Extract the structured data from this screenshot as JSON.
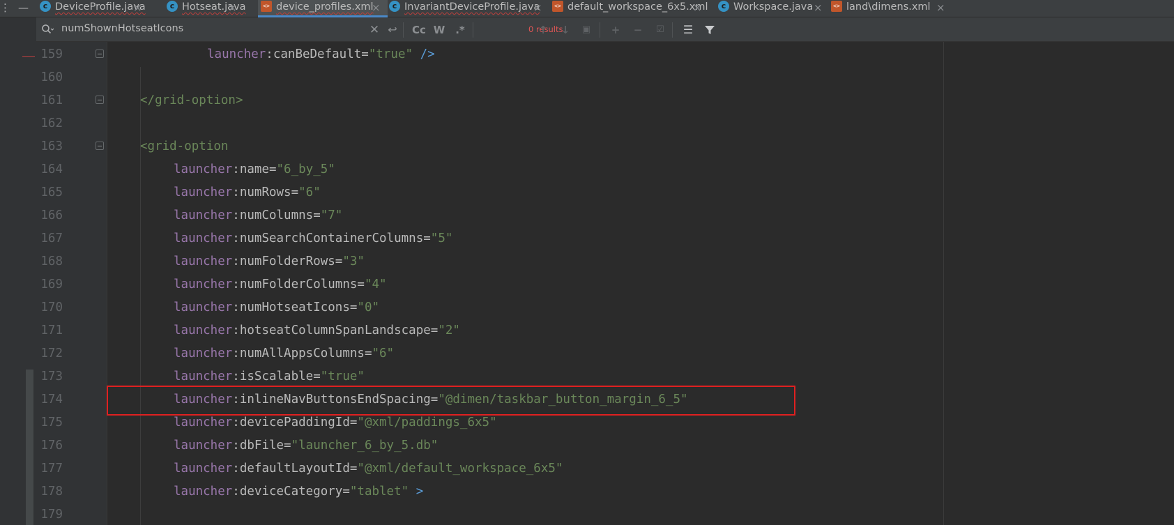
{
  "tabs": [
    {
      "label": "DeviceProfile.java",
      "icon": "java",
      "error": true
    },
    {
      "label": "Hotseat.java",
      "icon": "java",
      "error": true
    },
    {
      "label": "device_profiles.xml",
      "icon": "xml",
      "error": true,
      "active": true
    },
    {
      "label": "InvariantDeviceProfile.java",
      "icon": "java",
      "error": true
    },
    {
      "label": "default_workspace_6x5.xml",
      "icon": "xml",
      "error": false
    },
    {
      "label": "Workspace.java",
      "icon": "java",
      "error": false
    },
    {
      "label": "land\\dimens.xml",
      "icon": "xml",
      "error": false
    }
  ],
  "search": {
    "query": "numShownHotseatIcons",
    "results": "0 results",
    "match_case": "Cc",
    "words": "W",
    "regex": ".*"
  },
  "colors": {
    "namespace": "#9876aa",
    "string_value": "#6a8759",
    "tag": "#e8bf6a",
    "highlight_box": "#e02020",
    "results_text": "#e05555"
  },
  "code": {
    "lines": [
      {
        "num": "159",
        "parts": [
          {
            "t": "launcher",
            "c": "ns"
          },
          {
            "t": ":canBeDefault=",
            "c": "attr"
          },
          {
            "t": "\"true\"",
            "c": "val"
          },
          {
            "t": " />",
            "c": "selfclose"
          }
        ]
      },
      {
        "num": "160",
        "parts": []
      },
      {
        "num": "161",
        "parts": [
          {
            "t": "</grid-option>",
            "c": "val"
          }
        ]
      },
      {
        "num": "162",
        "parts": []
      },
      {
        "num": "163",
        "parts": [
          {
            "t": "<grid-option",
            "c": "val"
          }
        ]
      },
      {
        "num": "164",
        "parts": [
          {
            "t": "launcher",
            "c": "ns"
          },
          {
            "t": ":name=",
            "c": "attr"
          },
          {
            "t": "\"6_by_5\"",
            "c": "val"
          }
        ]
      },
      {
        "num": "165",
        "parts": [
          {
            "t": "launcher",
            "c": "ns"
          },
          {
            "t": ":numRows=",
            "c": "attr"
          },
          {
            "t": "\"6\"",
            "c": "val"
          }
        ]
      },
      {
        "num": "166",
        "parts": [
          {
            "t": "launcher",
            "c": "ns"
          },
          {
            "t": ":numColumns=",
            "c": "attr"
          },
          {
            "t": "\"7\"",
            "c": "val"
          }
        ]
      },
      {
        "num": "167",
        "parts": [
          {
            "t": "launcher",
            "c": "ns"
          },
          {
            "t": ":numSearchContainerColumns=",
            "c": "attr"
          },
          {
            "t": "\"5\"",
            "c": "val"
          }
        ]
      },
      {
        "num": "168",
        "parts": [
          {
            "t": "launcher",
            "c": "ns"
          },
          {
            "t": ":numFolderRows=",
            "c": "attr"
          },
          {
            "t": "\"3\"",
            "c": "val"
          }
        ]
      },
      {
        "num": "169",
        "parts": [
          {
            "t": "launcher",
            "c": "ns"
          },
          {
            "t": ":numFolderColumns=",
            "c": "attr"
          },
          {
            "t": "\"4\"",
            "c": "val"
          }
        ]
      },
      {
        "num": "170",
        "parts": [
          {
            "t": "launcher",
            "c": "ns"
          },
          {
            "t": ":numHotseatIcons=",
            "c": "attr"
          },
          {
            "t": "\"0\"",
            "c": "val"
          }
        ]
      },
      {
        "num": "171",
        "parts": [
          {
            "t": "launcher",
            "c": "ns"
          },
          {
            "t": ":hotseatColumnSpanLandscape=",
            "c": "attr"
          },
          {
            "t": "\"2\"",
            "c": "val"
          }
        ]
      },
      {
        "num": "172",
        "parts": [
          {
            "t": "launcher",
            "c": "ns"
          },
          {
            "t": ":numAllAppsColumns=",
            "c": "attr"
          },
          {
            "t": "\"6\"",
            "c": "val"
          }
        ]
      },
      {
        "num": "173",
        "parts": [
          {
            "t": "launcher",
            "c": "ns"
          },
          {
            "t": ":isScalable=",
            "c": "attr"
          },
          {
            "t": "\"true\"",
            "c": "val"
          }
        ]
      },
      {
        "num": "174",
        "parts": [
          {
            "t": "launcher",
            "c": "ns"
          },
          {
            "t": ":inlineNavButtonsEndSpacing=",
            "c": "attr"
          },
          {
            "t": "\"@dimen/taskbar_button_margin_6_5\"",
            "c": "val"
          }
        ]
      },
      {
        "num": "175",
        "parts": [
          {
            "t": "launcher",
            "c": "ns"
          },
          {
            "t": ":devicePaddingId=",
            "c": "attr"
          },
          {
            "t": "\"@xml/paddings_6x5\"",
            "c": "val"
          }
        ]
      },
      {
        "num": "176",
        "parts": [
          {
            "t": "launcher",
            "c": "ns"
          },
          {
            "t": ":dbFile=",
            "c": "attr"
          },
          {
            "t": "\"launcher_6_by_5.db\"",
            "c": "val"
          }
        ]
      },
      {
        "num": "177",
        "parts": [
          {
            "t": "launcher",
            "c": "ns"
          },
          {
            "t": ":defaultLayoutId=",
            "c": "attr"
          },
          {
            "t": "\"@xml/default_workspace_6x5\"",
            "c": "val"
          }
        ]
      },
      {
        "num": "178",
        "parts": [
          {
            "t": "launcher",
            "c": "ns"
          },
          {
            "t": ":deviceCategory=",
            "c": "attr"
          },
          {
            "t": "\"tablet\"",
            "c": "val"
          },
          {
            "t": " >",
            "c": "selfclose"
          }
        ]
      },
      {
        "num": "179",
        "parts": []
      }
    ]
  }
}
